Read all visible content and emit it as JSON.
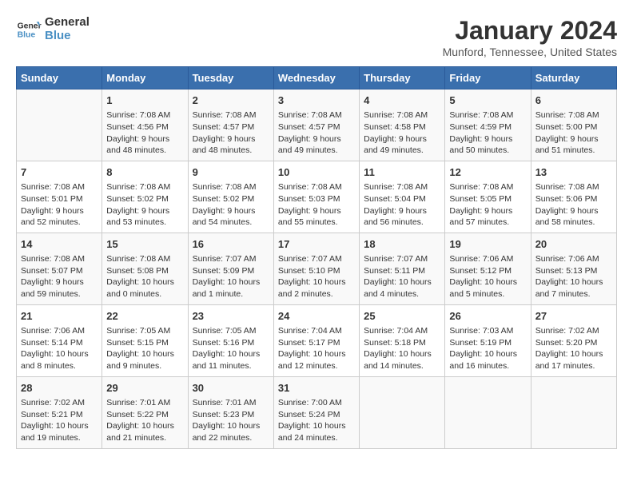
{
  "logo": {
    "line1": "General",
    "line2": "Blue"
  },
  "title": "January 2024",
  "location": "Munford, Tennessee, United States",
  "weekdays": [
    "Sunday",
    "Monday",
    "Tuesday",
    "Wednesday",
    "Thursday",
    "Friday",
    "Saturday"
  ],
  "weeks": [
    [
      {
        "day": "",
        "info": ""
      },
      {
        "day": "1",
        "info": "Sunrise: 7:08 AM\nSunset: 4:56 PM\nDaylight: 9 hours\nand 48 minutes."
      },
      {
        "day": "2",
        "info": "Sunrise: 7:08 AM\nSunset: 4:57 PM\nDaylight: 9 hours\nand 48 minutes."
      },
      {
        "day": "3",
        "info": "Sunrise: 7:08 AM\nSunset: 4:57 PM\nDaylight: 9 hours\nand 49 minutes."
      },
      {
        "day": "4",
        "info": "Sunrise: 7:08 AM\nSunset: 4:58 PM\nDaylight: 9 hours\nand 49 minutes."
      },
      {
        "day": "5",
        "info": "Sunrise: 7:08 AM\nSunset: 4:59 PM\nDaylight: 9 hours\nand 50 minutes."
      },
      {
        "day": "6",
        "info": "Sunrise: 7:08 AM\nSunset: 5:00 PM\nDaylight: 9 hours\nand 51 minutes."
      }
    ],
    [
      {
        "day": "7",
        "info": "Sunrise: 7:08 AM\nSunset: 5:01 PM\nDaylight: 9 hours\nand 52 minutes."
      },
      {
        "day": "8",
        "info": "Sunrise: 7:08 AM\nSunset: 5:02 PM\nDaylight: 9 hours\nand 53 minutes."
      },
      {
        "day": "9",
        "info": "Sunrise: 7:08 AM\nSunset: 5:02 PM\nDaylight: 9 hours\nand 54 minutes."
      },
      {
        "day": "10",
        "info": "Sunrise: 7:08 AM\nSunset: 5:03 PM\nDaylight: 9 hours\nand 55 minutes."
      },
      {
        "day": "11",
        "info": "Sunrise: 7:08 AM\nSunset: 5:04 PM\nDaylight: 9 hours\nand 56 minutes."
      },
      {
        "day": "12",
        "info": "Sunrise: 7:08 AM\nSunset: 5:05 PM\nDaylight: 9 hours\nand 57 minutes."
      },
      {
        "day": "13",
        "info": "Sunrise: 7:08 AM\nSunset: 5:06 PM\nDaylight: 9 hours\nand 58 minutes."
      }
    ],
    [
      {
        "day": "14",
        "info": "Sunrise: 7:08 AM\nSunset: 5:07 PM\nDaylight: 9 hours\nand 59 minutes."
      },
      {
        "day": "15",
        "info": "Sunrise: 7:08 AM\nSunset: 5:08 PM\nDaylight: 10 hours\nand 0 minutes."
      },
      {
        "day": "16",
        "info": "Sunrise: 7:07 AM\nSunset: 5:09 PM\nDaylight: 10 hours\nand 1 minute."
      },
      {
        "day": "17",
        "info": "Sunrise: 7:07 AM\nSunset: 5:10 PM\nDaylight: 10 hours\nand 2 minutes."
      },
      {
        "day": "18",
        "info": "Sunrise: 7:07 AM\nSunset: 5:11 PM\nDaylight: 10 hours\nand 4 minutes."
      },
      {
        "day": "19",
        "info": "Sunrise: 7:06 AM\nSunset: 5:12 PM\nDaylight: 10 hours\nand 5 minutes."
      },
      {
        "day": "20",
        "info": "Sunrise: 7:06 AM\nSunset: 5:13 PM\nDaylight: 10 hours\nand 7 minutes."
      }
    ],
    [
      {
        "day": "21",
        "info": "Sunrise: 7:06 AM\nSunset: 5:14 PM\nDaylight: 10 hours\nand 8 minutes."
      },
      {
        "day": "22",
        "info": "Sunrise: 7:05 AM\nSunset: 5:15 PM\nDaylight: 10 hours\nand 9 minutes."
      },
      {
        "day": "23",
        "info": "Sunrise: 7:05 AM\nSunset: 5:16 PM\nDaylight: 10 hours\nand 11 minutes."
      },
      {
        "day": "24",
        "info": "Sunrise: 7:04 AM\nSunset: 5:17 PM\nDaylight: 10 hours\nand 12 minutes."
      },
      {
        "day": "25",
        "info": "Sunrise: 7:04 AM\nSunset: 5:18 PM\nDaylight: 10 hours\nand 14 minutes."
      },
      {
        "day": "26",
        "info": "Sunrise: 7:03 AM\nSunset: 5:19 PM\nDaylight: 10 hours\nand 16 minutes."
      },
      {
        "day": "27",
        "info": "Sunrise: 7:02 AM\nSunset: 5:20 PM\nDaylight: 10 hours\nand 17 minutes."
      }
    ],
    [
      {
        "day": "28",
        "info": "Sunrise: 7:02 AM\nSunset: 5:21 PM\nDaylight: 10 hours\nand 19 minutes."
      },
      {
        "day": "29",
        "info": "Sunrise: 7:01 AM\nSunset: 5:22 PM\nDaylight: 10 hours\nand 21 minutes."
      },
      {
        "day": "30",
        "info": "Sunrise: 7:01 AM\nSunset: 5:23 PM\nDaylight: 10 hours\nand 22 minutes."
      },
      {
        "day": "31",
        "info": "Sunrise: 7:00 AM\nSunset: 5:24 PM\nDaylight: 10 hours\nand 24 minutes."
      },
      {
        "day": "",
        "info": ""
      },
      {
        "day": "",
        "info": ""
      },
      {
        "day": "",
        "info": ""
      }
    ]
  ]
}
